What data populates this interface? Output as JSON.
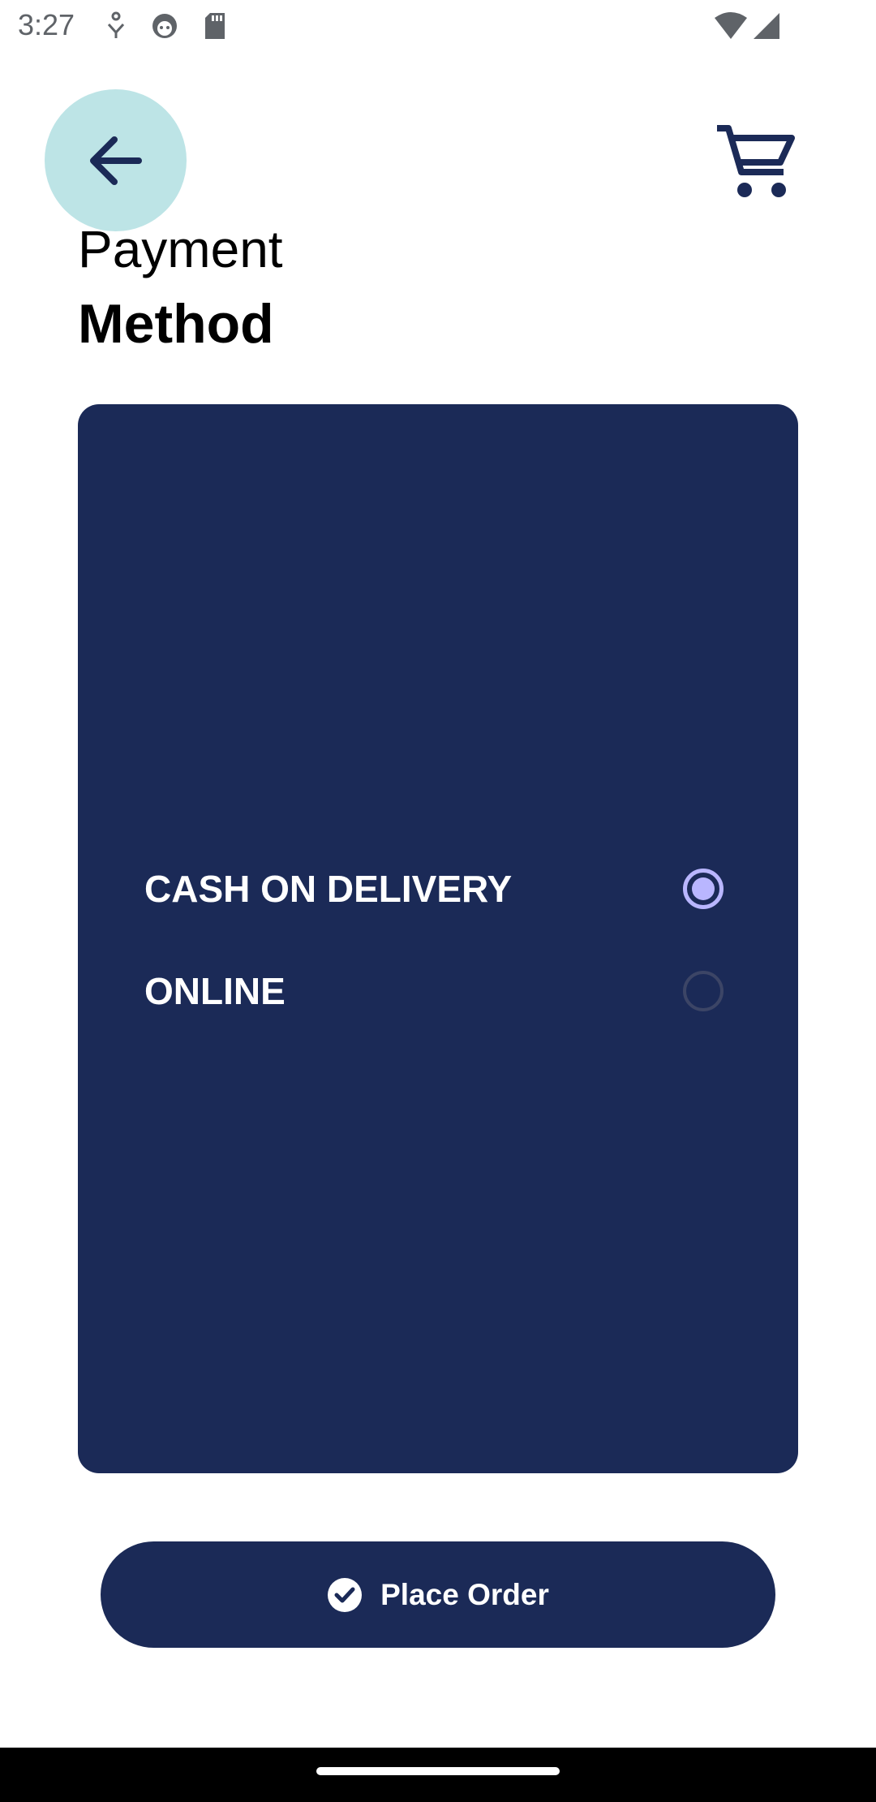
{
  "status_bar": {
    "time": "3:27",
    "icons": [
      "accessibility-icon",
      "face-icon",
      "sd-card-icon",
      "wifi-icon",
      "cellular-signal-icon"
    ]
  },
  "header": {
    "back_icon": "arrow-left-icon",
    "cart_icon": "shopping-cart-icon",
    "title_line1": "Payment",
    "title_line2": "Method"
  },
  "payment_options": [
    {
      "label": "CASH ON DELIVERY",
      "selected": true
    },
    {
      "label": "ONLINE",
      "selected": false
    }
  ],
  "place_order": {
    "label": "Place Order",
    "icon": "check-circle-icon"
  },
  "colors": {
    "primary": "#1b2a57",
    "back_button_bg": "#bde4e6",
    "radio_selected": "#b9b6ff"
  }
}
